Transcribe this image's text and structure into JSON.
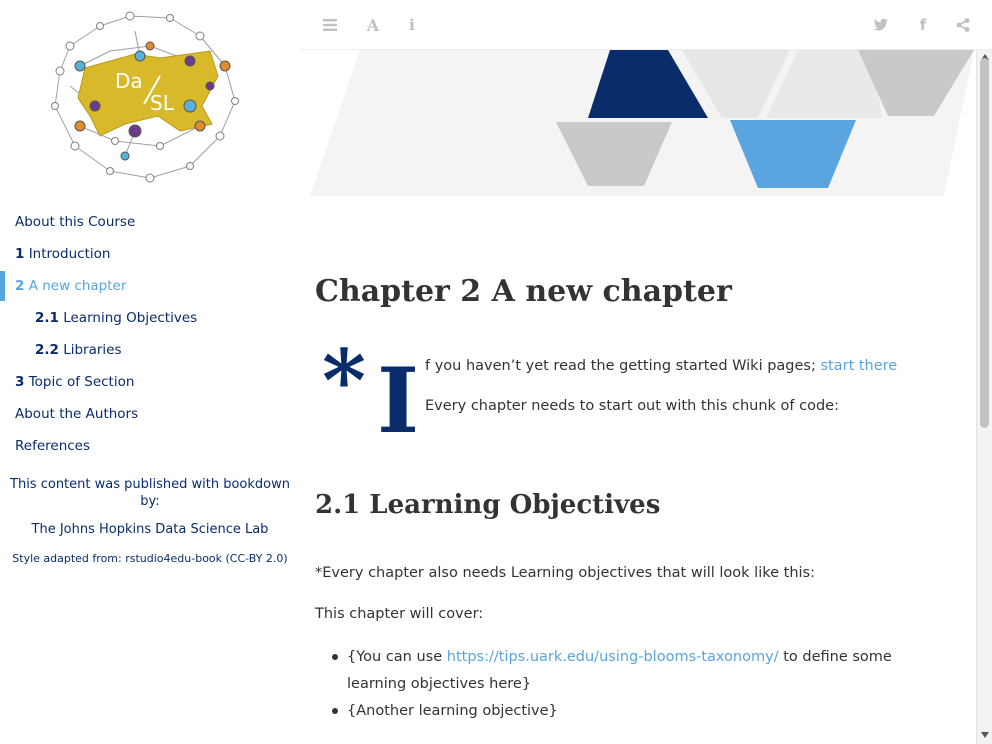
{
  "logo": {
    "icon": "dasl-network-logo",
    "text_left": "Da",
    "text_right": "SL"
  },
  "toolbar": {
    "toc_icon": "list-icon",
    "font_icon": "font-icon",
    "info_icon": "info-icon",
    "font_glyph": "A",
    "info_glyph": "i",
    "twitter_icon": "twitter-icon",
    "facebook_icon": "facebook-icon",
    "share_icon": "share-icon",
    "facebook_glyph": "f"
  },
  "sidebar": {
    "items": [
      {
        "num": "",
        "label": "About this Course"
      },
      {
        "num": "1",
        "label": "Introduction"
      },
      {
        "num": "2",
        "label": "A new chapter"
      },
      {
        "num": "2.1",
        "label": "Learning Objectives"
      },
      {
        "num": "2.2",
        "label": "Libraries"
      },
      {
        "num": "3",
        "label": "Topic of Section"
      },
      {
        "num": "",
        "label": "About the Authors"
      },
      {
        "num": "",
        "label": "References"
      }
    ],
    "published": "This content was published with bookdown by:",
    "lab": "The Johns Hopkins Data Science Lab",
    "style": "Style adapted from: rstudio4edu-book (CC-BY 2.0)"
  },
  "main": {
    "chapter_title": "Chapter 2   A new chapter",
    "dropcap_star": "*",
    "dropcap_letter": "I",
    "intro_text": "f you haven’t yet read the getting started Wiki pages; ",
    "intro_link": "start there",
    "code_text": "Every chapter needs to start out with this chunk of code:",
    "section_title": "2.1   Learning Objectives",
    "lo_intro": "*Every chapter also needs Learning objectives that will look like this:",
    "will_cover": "This chapter will cover:",
    "obj1_pre": "{You can use ",
    "obj1_link": "https://tips.uark.edu/using-blooms-taxonomy/",
    "obj1_post": " to define some learning objectives here}",
    "obj2": "{Another learning objective}"
  },
  "colors": {
    "navy": "#0a2c6b",
    "accent_blue": "#5aa4e0",
    "logo_yellow": "#d8b92a"
  }
}
